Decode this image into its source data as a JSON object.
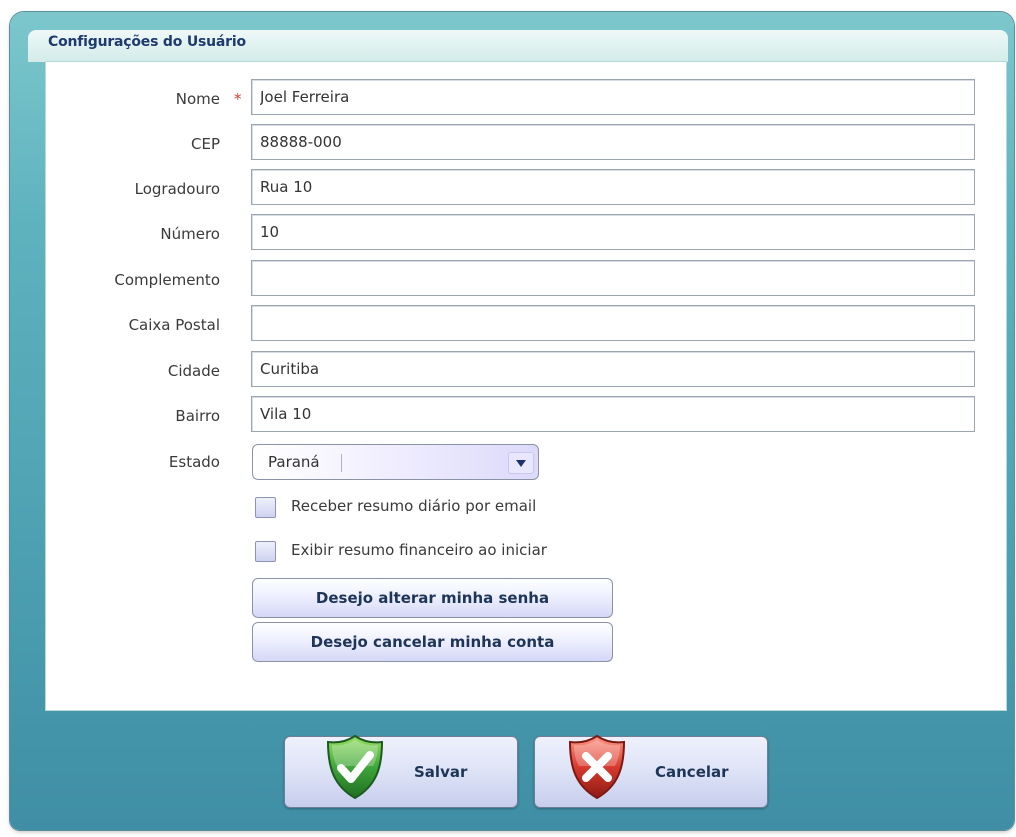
{
  "window": {
    "title": "Configurações do Usuário"
  },
  "form": {
    "nome": {
      "label": "Nome",
      "value": "Joel Ferreira",
      "required_mark": "*"
    },
    "cep": {
      "label": "CEP",
      "value": "88888-000"
    },
    "logradouro": {
      "label": "Logradouro",
      "value": "Rua 10"
    },
    "numero": {
      "label": "Número",
      "value": "10"
    },
    "complemento": {
      "label": "Complemento",
      "value": ""
    },
    "caixa_postal": {
      "label": "Caixa Postal",
      "value": ""
    },
    "cidade": {
      "label": "Cidade",
      "value": "Curitiba"
    },
    "bairro": {
      "label": "Bairro",
      "value": "Vila 10"
    },
    "estado": {
      "label": "Estado",
      "selected": "Paraná"
    }
  },
  "checkboxes": {
    "resumo_diario": {
      "label": "Receber resumo diário por email",
      "checked": false
    },
    "resumo_financeiro": {
      "label": "Exibir resumo financeiro ao iniciar",
      "checked": false
    }
  },
  "actions": {
    "alterar_senha": "Desejo alterar minha senha",
    "cancelar_conta": "Desejo cancelar minha conta"
  },
  "footer": {
    "save_label": "Salvar",
    "cancel_label": "Cancelar",
    "save_icon": "green-shield-check-icon",
    "cancel_icon": "red-shield-x-icon"
  },
  "colors": {
    "window_bg": "#4fa3b3",
    "title_text": "#1e3a6e",
    "required": "#d43a3a",
    "button_text": "#1e3558"
  }
}
